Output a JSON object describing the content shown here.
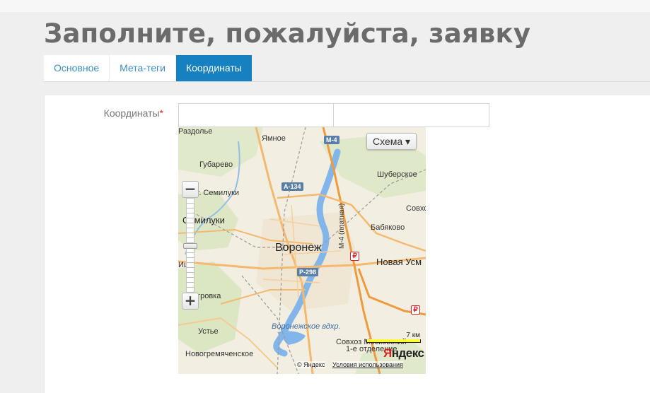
{
  "page": {
    "title": "Заполните, пожалуйста, заявку"
  },
  "tabs": [
    {
      "label": "Основное",
      "active": false
    },
    {
      "label": "Мета-теги",
      "active": false
    },
    {
      "label": "Координаты",
      "active": true
    }
  ],
  "form": {
    "coordinates_label": "Координаты",
    "required_mark": "*",
    "latitude_value": "",
    "longitude_value": ""
  },
  "map": {
    "type_button": "Схема ▾",
    "zoom_in": "+",
    "zoom_out": "−",
    "scale_label": "7 км",
    "logo_prefix": "Я",
    "logo_rest": "ндекс",
    "copyright": "© Яндекс",
    "terms_link": "Условия использования",
    "places": {
      "razdolye": "Раздолье",
      "yamnoe": "Ямное",
      "gubarevo": "Губарево",
      "shuberskoe": "Шуберское",
      "semiluki_station": "ст. Семилуки",
      "sovkhoz": "Совхо",
      "semiluki": "Семилуки",
      "babyakovo": "Бабяково",
      "voronezh": "Воронеж",
      "novaya_usman": "Новая Усм",
      "ica": "Ица",
      "ostrovka": "Островка",
      "ustye": "Устье",
      "novogremyachenskoe": "Новогремяченское",
      "reservoir": "Воронежское вдхр.",
      "sovkhoz_mosk": "Совхоз Московский",
      "first_dept": "1-е отделение"
    },
    "roads": {
      "m4": "М-4",
      "a134": "А-134",
      "r298": "Р-298",
      "m4_toll": "М-4 (платная)"
    },
    "ruble_sign": "₽"
  },
  "colors": {
    "accent": "#1581c1",
    "link": "#3a8fc7",
    "required": "#d9332f",
    "title": "#6b6b6b",
    "water": "#7fb3e8",
    "road": "#f6b26b",
    "park": "#cfe0b0"
  }
}
